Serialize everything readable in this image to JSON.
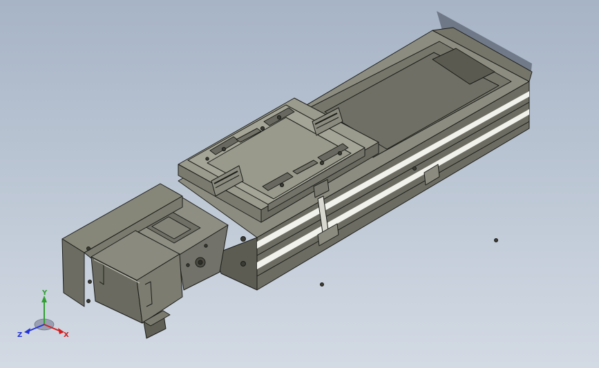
{
  "colors": {
    "background_top": "#a7b4c6",
    "background_bottom": "#d3dae4",
    "part_dark": "#5f5f56",
    "part_mid": "#7d7d72",
    "part_light": "#929286",
    "edge": "#1b1c18",
    "axis_x": "#d21f1f",
    "axis_y": "#2fa02f",
    "axis_z": "#2433d6"
  },
  "icons": {
    "model": "linear-actuator-module-icon",
    "triad": "coordinate-triad-icon"
  },
  "triad": {
    "x_label": "X",
    "y_label": "Y",
    "z_label": "Z"
  }
}
